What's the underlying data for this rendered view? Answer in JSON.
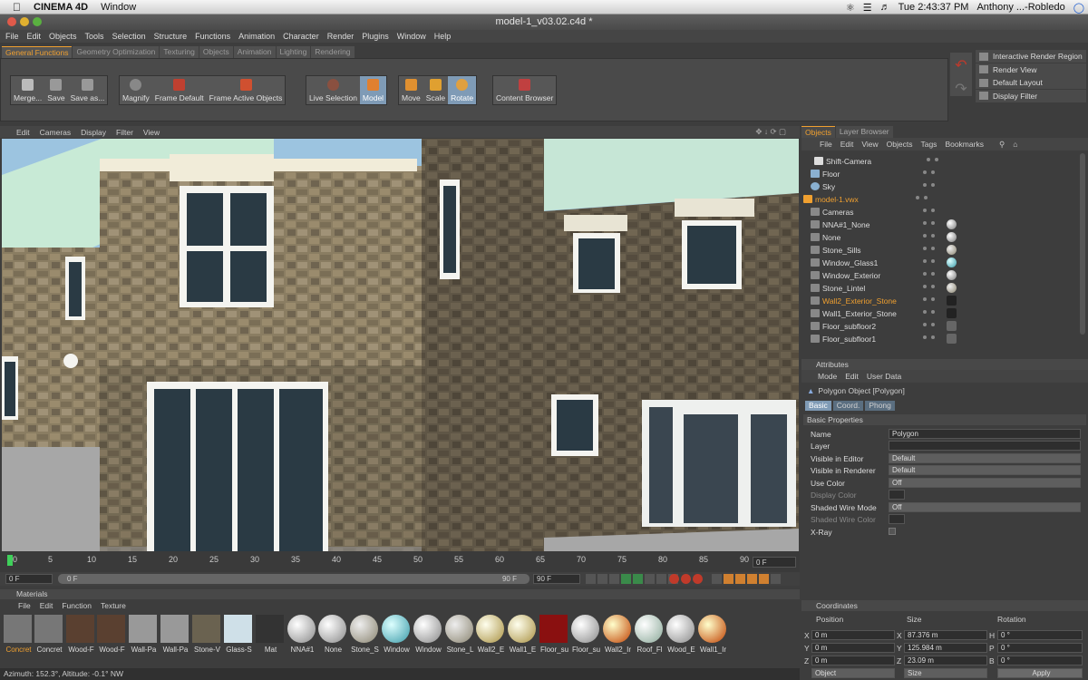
{
  "mac": {
    "apple_icon": "apple-icon",
    "app": "CINEMA 4D",
    "menu": "Window",
    "time": "Tue 2:43:37 PM",
    "user": "Anthony ...-Robledo"
  },
  "window": {
    "title": "model-1_v03.02.c4d *"
  },
  "menubar": [
    "File",
    "Edit",
    "Objects",
    "Tools",
    "Selection",
    "Structure",
    "Functions",
    "Animation",
    "Character",
    "Render",
    "Plugins",
    "Window",
    "Help"
  ],
  "tabs": [
    "General Functions",
    "Geometry Optimization",
    "Texturing",
    "Objects",
    "Animation",
    "Lighting",
    "Rendering"
  ],
  "toolbar": {
    "g1": [
      "Merge...",
      "Save",
      "Save as..."
    ],
    "g2": [
      "Magnify",
      "Frame Default",
      "Frame Active Objects"
    ],
    "g3": [
      "Live Selection",
      "Model"
    ],
    "g4": [
      "Move",
      "Scale",
      "Rotate"
    ],
    "g5": [
      "Content Browser"
    ]
  },
  "right_panel": [
    "Interactive Render Region",
    "Render View",
    "Default Layout",
    "Display Filter"
  ],
  "viewport_menu": [
    "Edit",
    "Cameras",
    "Display",
    "Filter",
    "View"
  ],
  "timeline": {
    "ticks": [
      "0",
      "5",
      "10",
      "15",
      "20",
      "25",
      "30",
      "35",
      "40",
      "45",
      "50",
      "55",
      "60",
      "65",
      "70",
      "75",
      "80",
      "85",
      "90"
    ],
    "frame_field": "0 F",
    "start": "0 F",
    "range_start": "0 F",
    "range_end": "90 F",
    "end": "90 F"
  },
  "materials": {
    "header": "Materials",
    "menu": [
      "File",
      "Edit",
      "Function",
      "Texture"
    ],
    "items": [
      "Concret",
      "Concret",
      "Wood-F",
      "Wood-F",
      "Wall-Pa",
      "Wall-Pa",
      "Stone-V",
      "Glass-S",
      "Mat",
      "NNA#1",
      "None",
      "Stone_S",
      "Window",
      "Window",
      "Stone_L",
      "Wall2_E",
      "Wall1_E",
      "Floor_su",
      "Floor_su",
      "Wall2_Ir",
      "Roof_Fl",
      "Wood_E",
      "Wall1_Ir"
    ]
  },
  "objects": {
    "tabs": [
      "Objects",
      "Layer Browser"
    ],
    "menu": [
      "File",
      "Edit",
      "View",
      "Objects",
      "Tags",
      "Bookmarks"
    ],
    "rows": [
      "Shift-Camera",
      "Floor",
      "Sky",
      "model-1.vwx",
      "Cameras",
      "NNA#1_None",
      "None",
      "Stone_Sills",
      "Window_Glass1",
      "Window_Exterior",
      "Stone_Lintel",
      "Wall2_Exterior_Stone",
      "Wall1_Exterior_Stone",
      "Floor_subfloor2",
      "Floor_subfloor1"
    ]
  },
  "attributes": {
    "header": "Attributes",
    "menu": [
      "Mode",
      "Edit",
      "User Data"
    ],
    "object": "Polygon Object [Polygon]",
    "tabs": [
      "Basic",
      "Coord.",
      "Phong"
    ],
    "section": "Basic Properties",
    "rows": [
      {
        "label": "Name",
        "value": "Polygon"
      },
      {
        "label": "Layer",
        "value": ""
      },
      {
        "label": "Visible in Editor",
        "value": "Default"
      },
      {
        "label": "Visible in Renderer",
        "value": "Default"
      },
      {
        "label": "Use Color",
        "value": "Off"
      },
      {
        "label": "Display Color",
        "value": ""
      },
      {
        "label": "Shaded Wire Mode",
        "value": "Off"
      },
      {
        "label": "Shaded Wire Color",
        "value": ""
      },
      {
        "label": "X-Ray",
        "value": ""
      }
    ]
  },
  "coordinates": {
    "header": "Coordinates",
    "cols": [
      "Position",
      "Size",
      "Rotation"
    ],
    "rows": [
      {
        "axis": "X",
        "pos": "0 m",
        "saxis": "X",
        "size": "87.376 m",
        "raxis": "H",
        "rot": "0 °"
      },
      {
        "axis": "Y",
        "pos": "0 m",
        "saxis": "Y",
        "size": "125.984 m",
        "raxis": "P",
        "rot": "0 °"
      },
      {
        "axis": "Z",
        "pos": "0 m",
        "saxis": "Z",
        "size": "23.09 m",
        "raxis": "B",
        "rot": "0 °"
      }
    ],
    "mode1": "Object",
    "mode2": "Size",
    "apply": "Apply"
  },
  "status": "Azimuth: 152.3°, Altitude: -0.1°  NW",
  "colors": {
    "accent": "#f0a030",
    "active": "#7f9bb6"
  }
}
